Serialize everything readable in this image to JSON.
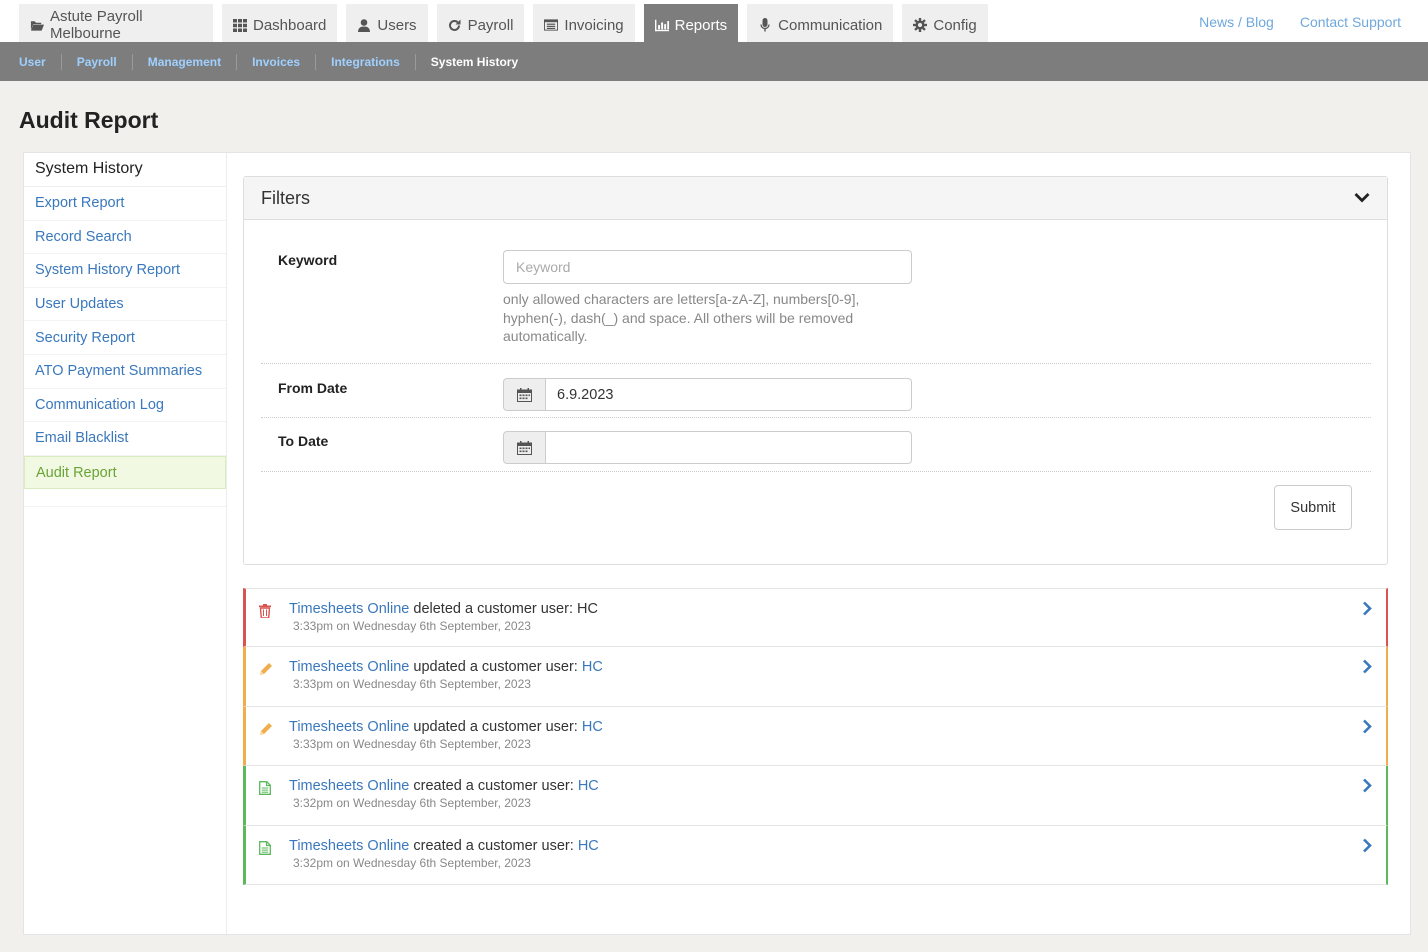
{
  "topnav": {
    "tabs": [
      {
        "label": "Astute Payroll Melbourne",
        "icon": "folder-open-icon"
      },
      {
        "label": "Dashboard",
        "icon": "th-icon"
      },
      {
        "label": "Users",
        "icon": "user-icon"
      },
      {
        "label": "Payroll",
        "icon": "refresh-icon"
      },
      {
        "label": "Invoicing",
        "icon": "list-alt-icon"
      },
      {
        "label": "Reports",
        "icon": "bar-chart-icon",
        "active": true
      },
      {
        "label": "Communication",
        "icon": "microphone-icon"
      },
      {
        "label": "Config",
        "icon": "cog-icon"
      }
    ],
    "links": [
      "News / Blog",
      "Contact Support"
    ]
  },
  "subnav": [
    "User",
    "Payroll",
    "Management",
    "Invoices",
    "Integrations",
    "System History"
  ],
  "page_title": "Audit Report",
  "sidebar": {
    "heading": "System History",
    "items": [
      "Export Report",
      "Record Search",
      "System History Report",
      "User Updates",
      "Security Report",
      "ATO Payment Summaries",
      "Communication Log",
      "Email Blacklist",
      "Audit Report"
    ],
    "active": "Audit Report"
  },
  "filters": {
    "title": "Filters",
    "keyword_label": "Keyword",
    "keyword_placeholder": "Keyword",
    "keyword_value": "",
    "keyword_help": "only allowed characters are letters[a-zA-Z], numbers[0-9], hyphen(-), dash(_) and space. All others will be removed automatically.",
    "from_label": "From Date",
    "from_value": "6.9.2023",
    "to_label": "To Date",
    "to_value": "",
    "submit_label": "Submit"
  },
  "log": [
    {
      "actor": "Timesheets Online",
      "action": "deleted a customer user:",
      "target": "HC",
      "target_link": false,
      "time": "3:33pm on Wednesday 6th September, 2023",
      "kind": "delete",
      "icon": "trash-icon",
      "color": "#d9534f"
    },
    {
      "actor": "Timesheets Online",
      "action": "updated a customer user:",
      "target": "HC",
      "target_link": true,
      "time": "3:33pm on Wednesday 6th September, 2023",
      "kind": "update",
      "icon": "pencil-icon",
      "color": "#f0ad4e"
    },
    {
      "actor": "Timesheets Online",
      "action": "updated a customer user:",
      "target": "HC",
      "target_link": true,
      "time": "3:33pm on Wednesday 6th September, 2023",
      "kind": "update",
      "icon": "pencil-icon",
      "color": "#f0ad4e"
    },
    {
      "actor": "Timesheets Online",
      "action": "created a customer user:",
      "target": "HC",
      "target_link": true,
      "time": "3:32pm on Wednesday 6th September, 2023",
      "kind": "create",
      "icon": "file-icon",
      "color": "#5cb85c"
    },
    {
      "actor": "Timesheets Online",
      "action": "created a customer user:",
      "target": "HC",
      "target_link": true,
      "time": "3:32pm on Wednesday 6th September, 2023",
      "kind": "create",
      "icon": "file-icon",
      "color": "#5cb85c"
    }
  ]
}
